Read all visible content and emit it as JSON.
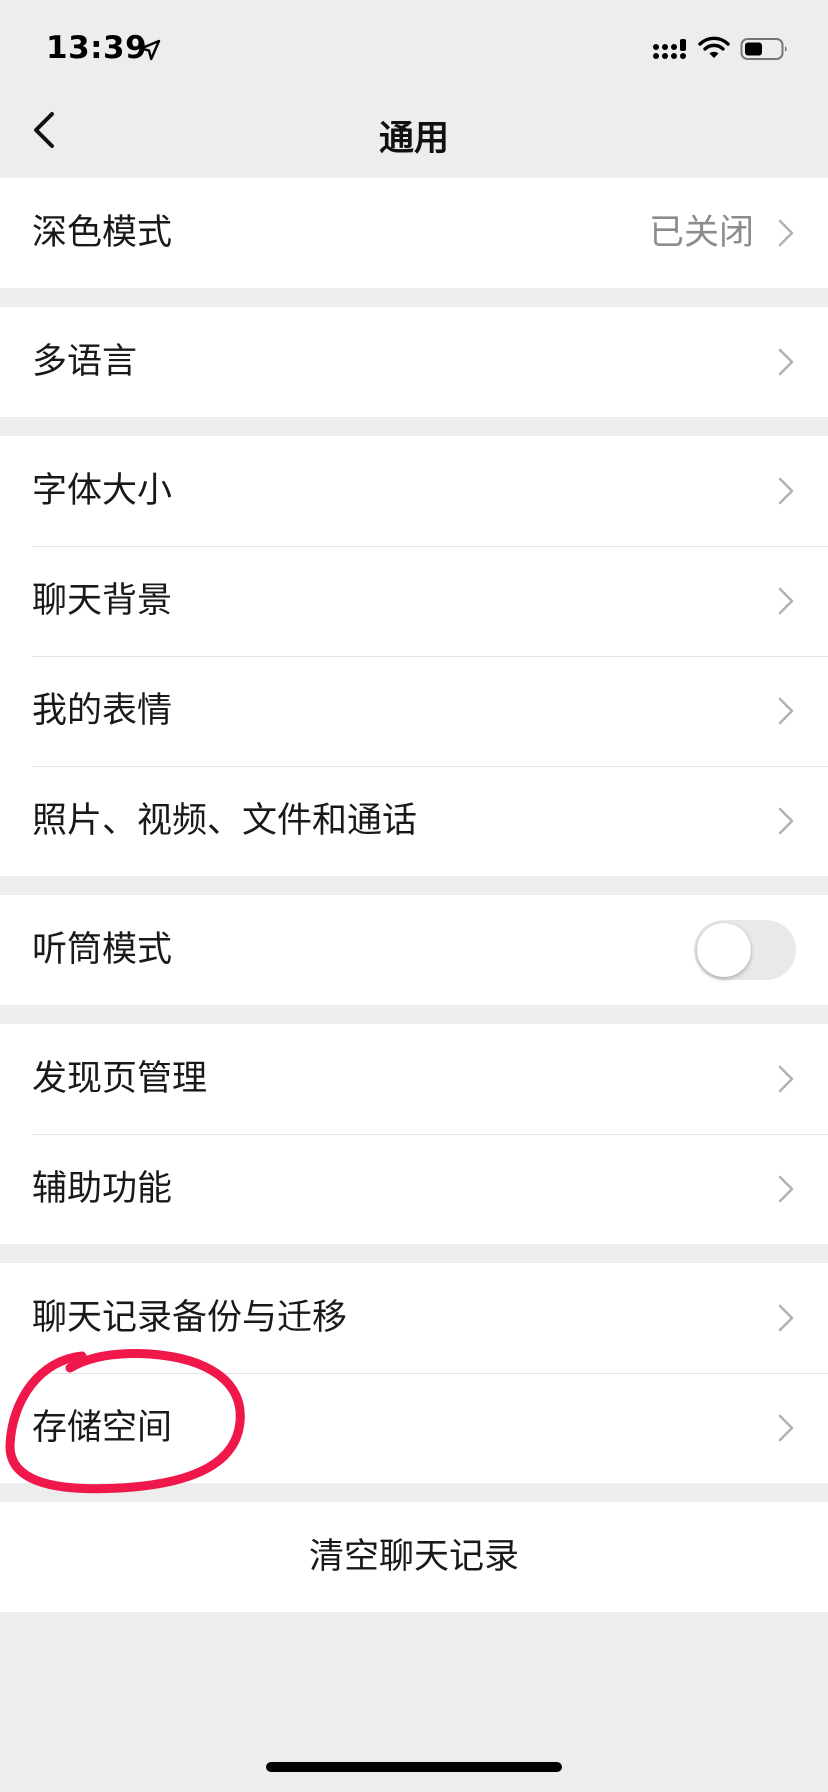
{
  "status_bar": {
    "time": "13:39",
    "icons": [
      "location-arrow-icon",
      "cellular-signal-icon",
      "wifi-icon",
      "battery-icon"
    ]
  },
  "nav": {
    "title": "通用",
    "back_icon": "chevron-left-icon"
  },
  "groups": [
    {
      "items": [
        {
          "label": "深色模式",
          "value": "已关闭",
          "accessory": "chevron"
        }
      ]
    },
    {
      "items": [
        {
          "label": "多语言",
          "accessory": "chevron"
        }
      ]
    },
    {
      "items": [
        {
          "label": "字体大小",
          "accessory": "chevron"
        },
        {
          "label": "聊天背景",
          "accessory": "chevron"
        },
        {
          "label": "我的表情",
          "accessory": "chevron"
        },
        {
          "label": "照片、视频、文件和通话",
          "accessory": "chevron"
        }
      ]
    },
    {
      "items": [
        {
          "label": "听筒模式",
          "accessory": "toggle",
          "toggle_on": false
        }
      ]
    },
    {
      "items": [
        {
          "label": "发现页管理",
          "accessory": "chevron"
        },
        {
          "label": "辅助功能",
          "accessory": "chevron"
        }
      ]
    },
    {
      "items": [
        {
          "label": "聊天记录备份与迁移",
          "accessory": "chevron"
        },
        {
          "label": "存储空间",
          "accessory": "chevron"
        }
      ]
    }
  ],
  "clear_action": {
    "label": "清空聊天记录"
  },
  "colors": {
    "background": "#ededed",
    "cell": "#ffffff",
    "text": "#191919",
    "secondary_text": "#8c8c8c",
    "annotation": "#f0174b"
  }
}
